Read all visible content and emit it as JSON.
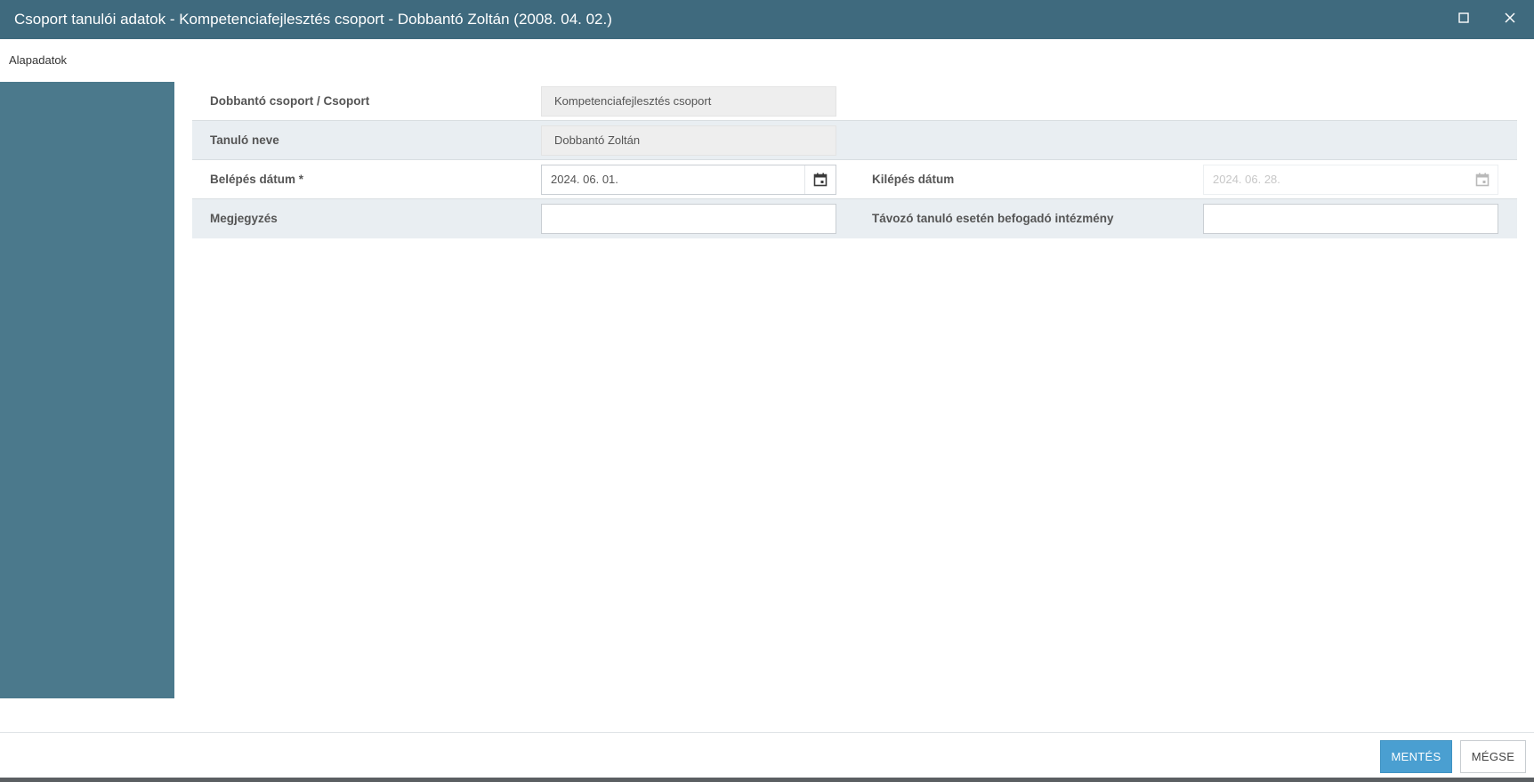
{
  "window": {
    "title": "Csoport tanulói adatok - Kompetenciafejlesztés csoport - Dobbantó Zoltán (2008. 04. 02.)",
    "maximize_icon": "maximize-icon",
    "close_icon": "close-icon"
  },
  "tabs": [
    {
      "label": "Alapadatok",
      "active": true
    }
  ],
  "form": {
    "group": {
      "label": "Dobbantó csoport / Csoport",
      "value": "Kompetenciafejlesztés csoport"
    },
    "student": {
      "label": "Tanuló neve",
      "value": "Dobbantó Zoltán"
    },
    "entry_date": {
      "label": "Belépés dátum *",
      "value": "2024. 06. 01.",
      "icon": "calendar-icon"
    },
    "exit_date": {
      "label": "Kilépés dátum",
      "value": "2024. 06. 28.",
      "disabled": true,
      "icon": "calendar-icon"
    },
    "note": {
      "label": "Megjegyzés",
      "value": ""
    },
    "receiving_institution": {
      "label": "Távozó tanuló esetén befogadó intézmény",
      "value": ""
    }
  },
  "footer": {
    "save_label": "MENTÉS",
    "cancel_label": "MÉGSE"
  },
  "colors": {
    "titlebar": "#3f6a7e",
    "sidebar": "#4b798c",
    "primary_button": "#4a9fd1",
    "row_shade": "#e9eef2"
  }
}
